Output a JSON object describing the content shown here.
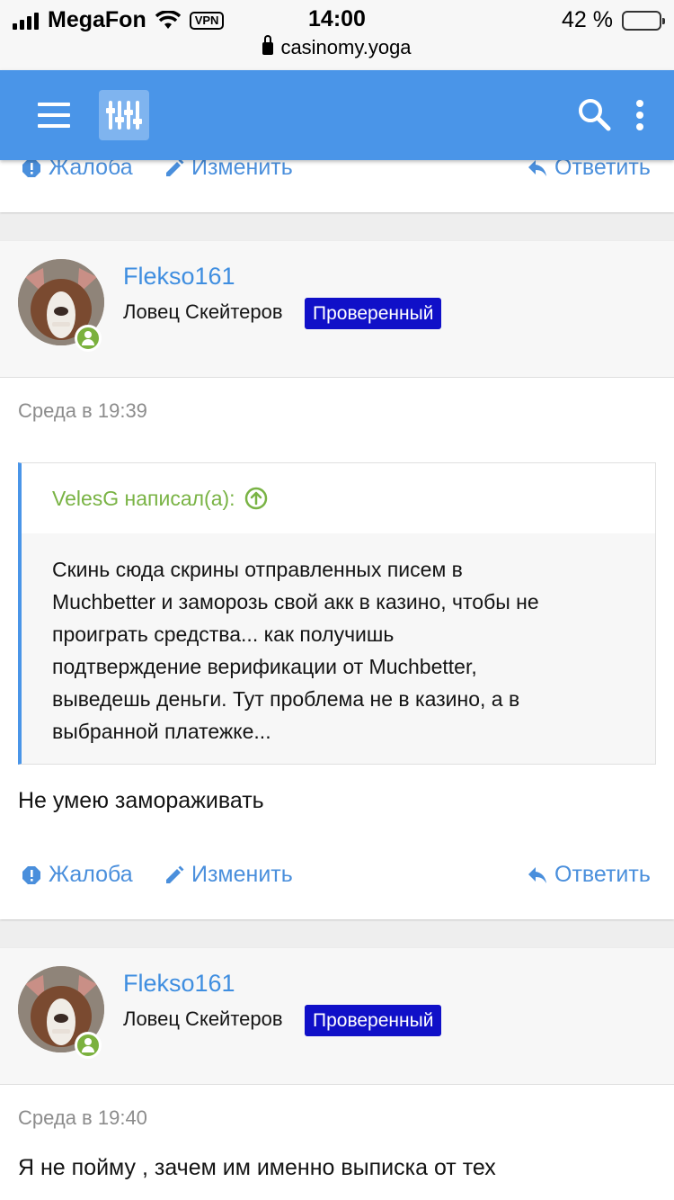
{
  "status_bar": {
    "carrier": "MegaFon",
    "vpn": "VPN",
    "time": "14:00",
    "url": "casinomy.yoga",
    "battery": "42 %",
    "battery_level": 0.42
  },
  "actions": {
    "report": "Жалоба",
    "edit": "Изменить",
    "reply": "Ответить"
  },
  "posts": [
    {
      "username": "Flekso161",
      "user_title": "Ловец Скейтеров",
      "badge": "Проверенный",
      "date": "Среда в 19:39",
      "quote": {
        "author": "VelesG написал(а):",
        "lines": [
          "Скинь сюда скрины отправленных писем в",
          "Muchbetter и заморозь свой акк в казино, чтобы не",
          "проиграть средства... как получишь",
          "подтверждение верификации от Muchbetter,",
          "выведешь деньги. Тут проблема не в казино, а в",
          "выбранной платежке..."
        ]
      },
      "message": "Не умею замораживать"
    },
    {
      "username": "Flekso161",
      "user_title": "Ловец Скейтеров",
      "badge": "Проверенный",
      "date": "Среда в 19:40",
      "message": "Я не пойму , зачем им именно выписка от тех"
    }
  ],
  "colors": {
    "nav": "#4a95e8",
    "link": "#4a8fdc",
    "badge": "#1010c8",
    "quote_author": "#79b344",
    "online": "#7bb13e"
  }
}
